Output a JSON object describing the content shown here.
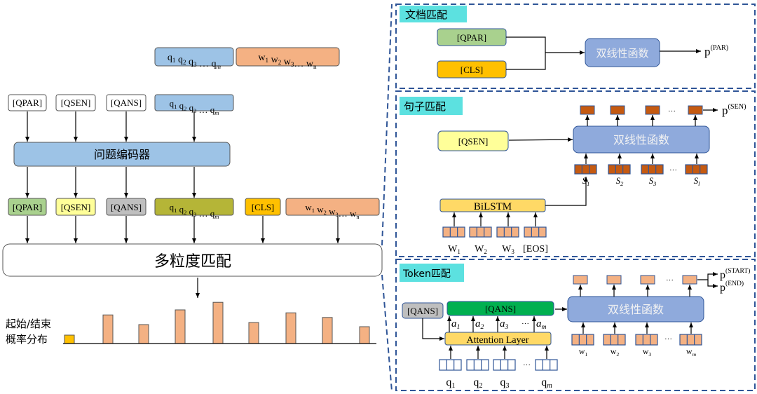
{
  "left": {
    "top_q": [
      {
        "b": "q",
        "s": "1"
      },
      {
        "b": " q",
        "s": "2"
      },
      {
        "b": " q",
        "s": "3"
      },
      {
        "b": " … q",
        "s": "m"
      }
    ],
    "top_w": [
      {
        "b": "w",
        "s": "1"
      },
      {
        "b": " w",
        "s": "2"
      },
      {
        "b": " w",
        "s": "3"
      },
      {
        "b": "… w",
        "s": "n"
      }
    ],
    "tokens_in": [
      "[QPAR]",
      "[QSEN]",
      "[QANS]"
    ],
    "encoder": "问题编码器",
    "tokens_out": [
      "[QPAR]",
      "[QSEN]",
      "[QANS]"
    ],
    "cls": "[CLS]",
    "matcher": "多粒度匹配",
    "prob_label_1": "起始/结束",
    "prob_label_2": "概率分布",
    "prob_bars": [
      0.2,
      0.68,
      0.45,
      0.8,
      0.98,
      0.5,
      0.73,
      0.62,
      0.4
    ]
  },
  "doc": {
    "title": "文档匹配",
    "qpar": "[QPAR]",
    "cls": "[CLS]",
    "bilinear": "双线性函数",
    "out": {
      "b": "p",
      "sup": "(PAR)"
    }
  },
  "sen": {
    "title": "句子匹配",
    "qsen": "[QSEN]",
    "bilinear": "双线性函数",
    "ellipsis": "···",
    "out": {
      "b": "p",
      "sup": "(SEN)"
    },
    "s_labels": [
      {
        "b": "S",
        "s": "1"
      },
      {
        "b": "S",
        "s": "2"
      },
      {
        "b": "S",
        "s": "3"
      },
      {
        "b": "S",
        "s": "l"
      }
    ],
    "bilstm": "BiLSTM",
    "w_labels": [
      {
        "b": "W",
        "s": "1"
      },
      {
        "b": "W",
        "s": "2"
      },
      {
        "b": "W",
        "s": "3"
      },
      {
        "b": "[EOS]",
        "s": ""
      }
    ]
  },
  "tok": {
    "title": "Token匹配",
    "qans_in": "[QANS]",
    "qans_out": "[QANS]",
    "a_labels": [
      {
        "b": "a",
        "s": "1"
      },
      {
        "b": "a",
        "s": "2"
      },
      {
        "b": "a",
        "s": "3"
      },
      {
        "b": "a",
        "s": "m"
      }
    ],
    "ellipsis": "···",
    "attention": "Attention Layer",
    "q_labels": [
      {
        "b": "q",
        "s": "1"
      },
      {
        "b": "q",
        "s": "2"
      },
      {
        "b": "q",
        "s": "3"
      },
      {
        "b": "q",
        "s": "m"
      }
    ],
    "bilinear": "双线性函数",
    "w_labels": [
      {
        "b": "w",
        "s": "1"
      },
      {
        "b": "w",
        "s": "2"
      },
      {
        "b": "w",
        "s": "3"
      },
      {
        "b": "w",
        "s": "m"
      }
    ],
    "out_start": {
      "b": "p",
      "sup": "(START)"
    },
    "out_end": {
      "b": "p",
      "sup": "(END)"
    }
  },
  "colors": {
    "blue_box": "#9dc3e6",
    "orange": "#f4b183",
    "green_light": "#a9d18e",
    "yellow_light": "#ffff99",
    "gray": "#bfbfbf",
    "olive": "#b5b537",
    "cls": "#ffc000",
    "bilinear": "#8faadc",
    "brown": "#c55a11",
    "title_bg": "#5ce1e0",
    "green_dark": "#00b050",
    "attention": "#ffd966",
    "dashed": "#2f5597"
  }
}
